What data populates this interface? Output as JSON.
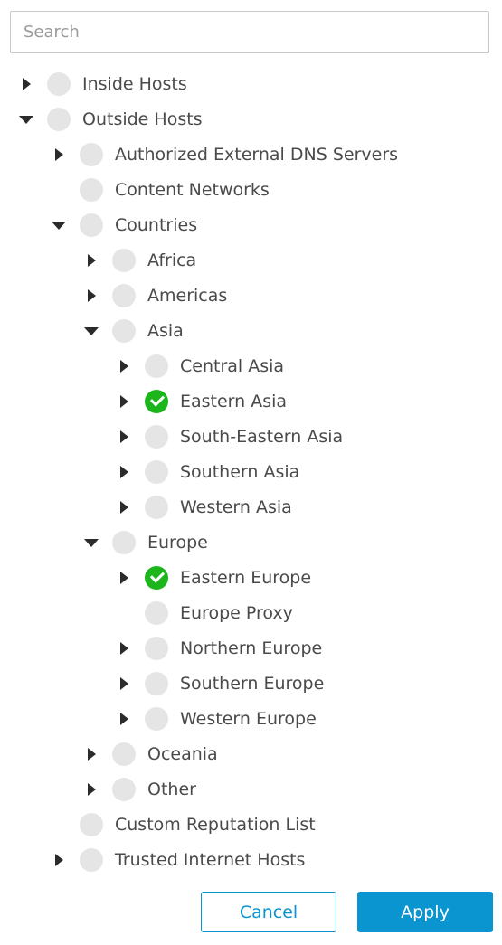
{
  "search": {
    "placeholder": "Search",
    "value": ""
  },
  "tree": [
    {
      "label": "Inside Hosts",
      "level": 0,
      "toggle": "collapsed",
      "checked": false
    },
    {
      "label": "Outside Hosts",
      "level": 0,
      "toggle": "expanded",
      "checked": false
    },
    {
      "label": "Authorized External DNS Servers",
      "level": 1,
      "toggle": "collapsed",
      "checked": false
    },
    {
      "label": "Content Networks",
      "level": 1,
      "toggle": "none",
      "checked": false
    },
    {
      "label": "Countries",
      "level": 1,
      "toggle": "expanded",
      "checked": false
    },
    {
      "label": "Africa",
      "level": 2,
      "toggle": "collapsed",
      "checked": false
    },
    {
      "label": "Americas",
      "level": 2,
      "toggle": "collapsed",
      "checked": false
    },
    {
      "label": "Asia",
      "level": 2,
      "toggle": "expanded",
      "checked": false
    },
    {
      "label": "Central Asia",
      "level": 3,
      "toggle": "collapsed",
      "checked": false
    },
    {
      "label": "Eastern Asia",
      "level": 3,
      "toggle": "collapsed",
      "checked": true
    },
    {
      "label": "South-Eastern Asia",
      "level": 3,
      "toggle": "collapsed",
      "checked": false
    },
    {
      "label": "Southern Asia",
      "level": 3,
      "toggle": "collapsed",
      "checked": false
    },
    {
      "label": "Western Asia",
      "level": 3,
      "toggle": "collapsed",
      "checked": false
    },
    {
      "label": "Europe",
      "level": 2,
      "toggle": "expanded",
      "checked": false
    },
    {
      "label": "Eastern Europe",
      "level": 3,
      "toggle": "collapsed",
      "checked": true
    },
    {
      "label": "Europe Proxy",
      "level": 3,
      "toggle": "none",
      "checked": false
    },
    {
      "label": "Northern Europe",
      "level": 3,
      "toggle": "collapsed",
      "checked": false
    },
    {
      "label": "Southern Europe",
      "level": 3,
      "toggle": "collapsed",
      "checked": false
    },
    {
      "label": "Western Europe",
      "level": 3,
      "toggle": "collapsed",
      "checked": false
    },
    {
      "label": "Oceania",
      "level": 2,
      "toggle": "collapsed",
      "checked": false
    },
    {
      "label": "Other",
      "level": 2,
      "toggle": "collapsed",
      "checked": false
    },
    {
      "label": "Custom Reputation List",
      "level": 1,
      "toggle": "none",
      "checked": false
    },
    {
      "label": "Trusted Internet Hosts",
      "level": 1,
      "toggle": "collapsed",
      "checked": false
    }
  ],
  "buttons": {
    "cancel_label": "Cancel",
    "apply_label": "Apply"
  },
  "colors": {
    "accent": "#0b95d0",
    "checked": "#1cb51c",
    "unchecked": "#e5e5e5"
  },
  "icons": {
    "collapsed": "caret-right-icon",
    "expanded": "caret-down-icon",
    "checked": "check-circle-icon",
    "unchecked": "empty-circle-icon"
  }
}
